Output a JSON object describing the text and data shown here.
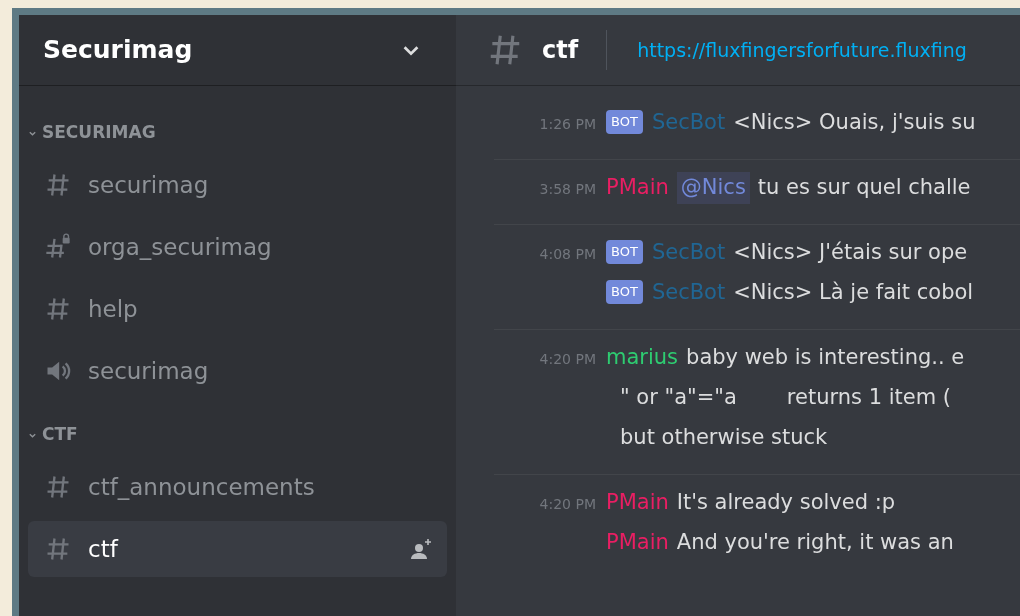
{
  "server": {
    "name": "Securimag"
  },
  "categories": [
    {
      "name": "SECURIMAG",
      "expanded": true,
      "channels": [
        {
          "kind": "text",
          "name": "securimag",
          "selected": false
        },
        {
          "kind": "private",
          "name": "orga_securimag",
          "selected": false
        },
        {
          "kind": "text",
          "name": "help",
          "selected": false
        },
        {
          "kind": "voice",
          "name": "securimag",
          "selected": false
        }
      ]
    },
    {
      "name": "CTF",
      "expanded": true,
      "channels": [
        {
          "kind": "text",
          "name": "ctf_announcements",
          "selected": false
        },
        {
          "kind": "text",
          "name": "ctf",
          "selected": true
        }
      ]
    }
  ],
  "header": {
    "channel": "ctf",
    "topic": "https://fluxfingersforfuture.fluxfing"
  },
  "messages": [
    {
      "time": "1:26 PM",
      "lines": [
        {
          "author": "SecBot",
          "color": "#206694",
          "badge": "BOT",
          "segments": [
            "<Nics> Ouais, j'suis su"
          ]
        }
      ]
    },
    {
      "time": "3:58 PM",
      "lines": [
        {
          "author": "PMain",
          "color": "#e91e63",
          "mention": "@Nics",
          "segments": [
            "tu es sur quel challe"
          ]
        }
      ]
    },
    {
      "time": "4:08 PM",
      "lines": [
        {
          "author": "SecBot",
          "color": "#206694",
          "badge": "BOT",
          "segments": [
            "<Nics> J'étais sur ope"
          ]
        },
        {
          "author": "SecBot",
          "color": "#206694",
          "badge": "BOT",
          "segments": [
            "<Nics> Là je fait cobol"
          ]
        }
      ]
    },
    {
      "time": "4:20 PM",
      "lines": [
        {
          "author": "marius",
          "color": "#2ecc71",
          "segments": [
            "baby web is interesting.. e"
          ]
        },
        {
          "segments": [
            "\" or \"a\"=\"a",
            "returns 1 item ("
          ]
        },
        {
          "segments": [
            "but otherwise stuck"
          ]
        }
      ]
    },
    {
      "time": "4:20 PM",
      "lines": [
        {
          "author": "PMain",
          "color": "#e91e63",
          "segments": [
            "It's already solved :p"
          ]
        },
        {
          "author": "PMain",
          "color": "#e91e63",
          "segments": [
            "And you're right, it was an"
          ]
        }
      ]
    }
  ]
}
